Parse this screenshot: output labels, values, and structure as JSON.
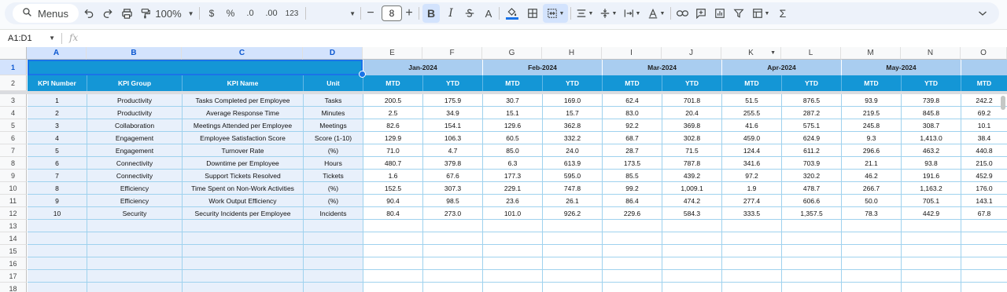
{
  "toolbar": {
    "menus_label": "Menus",
    "zoom": "100%",
    "currency": "$",
    "percent": "%",
    "dec_decrease": ".0",
    "dec_increase": ".00",
    "number_format": "123",
    "font_size": "8",
    "bold": "B",
    "italic": "I",
    "text_color": "A",
    "sigma": "Σ"
  },
  "name_box": "A1:D1",
  "formula_label": "fx",
  "columns": [
    "A",
    "B",
    "C",
    "D",
    "E",
    "F",
    "G",
    "H",
    "I",
    "J",
    "K",
    "L",
    "M",
    "N",
    "O"
  ],
  "row_numbers": [
    "1",
    "2",
    "3",
    "4",
    "5",
    "6",
    "7",
    "8",
    "9",
    "10",
    "11",
    "12",
    "13",
    "14",
    "15",
    "16",
    "17",
    "18"
  ],
  "months": [
    "Jan-2024",
    "Feb-2024",
    "Mar-2024",
    "Apr-2024",
    "May-2024"
  ],
  "headers": [
    "KPI Number",
    "KPI Group",
    "KPI Name",
    "Unit",
    "MTD",
    "YTD",
    "MTD",
    "YTD",
    "MTD",
    "YTD",
    "MTD",
    "YTD",
    "MTD",
    "YTD",
    "MTD"
  ],
  "rows": [
    [
      "1",
      "Productivity",
      "Tasks Completed per Employee",
      "Tasks",
      "200.5",
      "175.9",
      "30.7",
      "169.0",
      "62.4",
      "701.8",
      "51.5",
      "876.5",
      "93.9",
      "739.8",
      "242.2"
    ],
    [
      "2",
      "Productivity",
      "Average Response Time",
      "Minutes",
      "2.5",
      "34.9",
      "15.1",
      "15.7",
      "83.0",
      "20.4",
      "255.5",
      "287.2",
      "219.5",
      "845.8",
      "69.2"
    ],
    [
      "3",
      "Collaboration",
      "Meetings Attended per Employee",
      "Meetings",
      "82.6",
      "154.1",
      "129.6",
      "362.8",
      "92.2",
      "369.8",
      "41.6",
      "575.1",
      "245.8",
      "308.7",
      "10.1"
    ],
    [
      "4",
      "Engagement",
      "Employee Satisfaction Score",
      "Score (1-10)",
      "129.9",
      "106.3",
      "60.5",
      "332.2",
      "68.7",
      "302.8",
      "459.0",
      "624.9",
      "9.3",
      "1,413.0",
      "38.4"
    ],
    [
      "5",
      "Engagement",
      "Turnover Rate",
      "(%)",
      "71.0",
      "4.7",
      "85.0",
      "24.0",
      "28.7",
      "71.5",
      "124.4",
      "611.2",
      "296.6",
      "463.2",
      "440.8"
    ],
    [
      "6",
      "Connectivity",
      "Downtime per Employee",
      "Hours",
      "480.7",
      "379.8",
      "6.3",
      "613.9",
      "173.5",
      "787.8",
      "341.6",
      "703.9",
      "21.1",
      "93.8",
      "215.0"
    ],
    [
      "7",
      "Connectivity",
      "Support Tickets Resolved",
      "Tickets",
      "1.6",
      "67.6",
      "177.3",
      "595.0",
      "85.5",
      "439.2",
      "97.2",
      "320.2",
      "46.2",
      "191.6",
      "452.9"
    ],
    [
      "8",
      "Efficiency",
      "Time Spent on Non-Work Activities",
      "(%)",
      "152.5",
      "307.3",
      "229.1",
      "747.8",
      "99.2",
      "1,009.1",
      "1.9",
      "478.7",
      "266.7",
      "1,163.2",
      "176.0"
    ],
    [
      "9",
      "Efficiency",
      "Work Output Efficiency",
      "(%)",
      "90.4",
      "98.5",
      "23.6",
      "26.1",
      "86.4",
      "474.2",
      "277.4",
      "606.6",
      "50.0",
      "705.1",
      "143.1"
    ],
    [
      "10",
      "Security",
      "Security Incidents per Employee",
      "Incidents",
      "80.4",
      "273.0",
      "101.0",
      "926.2",
      "229.6",
      "584.3",
      "333.5",
      "1,357.5",
      "78.3",
      "442.9",
      "67.8"
    ]
  ]
}
